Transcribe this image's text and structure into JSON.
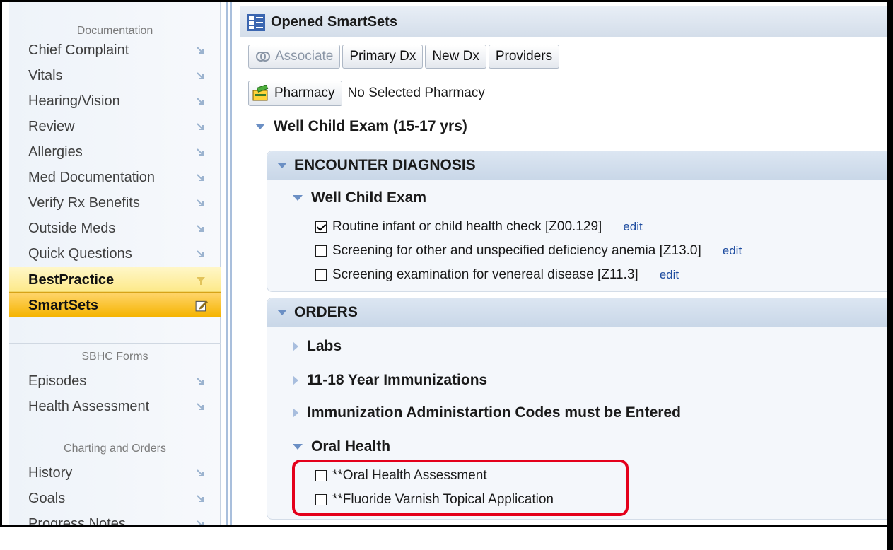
{
  "sidebar": {
    "sections": [
      {
        "heading": "Documentation",
        "items": [
          {
            "label": "Chief Complaint"
          },
          {
            "label": "Vitals"
          },
          {
            "label": "Hearing/Vision"
          },
          {
            "label": "Review"
          },
          {
            "label": "Allergies"
          },
          {
            "label": "Med Documentation"
          },
          {
            "label": "Verify Rx Benefits"
          },
          {
            "label": "Outside Meds"
          },
          {
            "label": "Quick Questions"
          },
          {
            "label": "BestPractice"
          },
          {
            "label": "SmartSets"
          }
        ]
      },
      {
        "heading": "SBHC Forms",
        "items": [
          {
            "label": "Episodes"
          },
          {
            "label": "Health Assessment"
          }
        ]
      },
      {
        "heading": "Charting and Orders",
        "items": [
          {
            "label": "History"
          },
          {
            "label": "Goals"
          },
          {
            "label": "Progress Notes"
          }
        ]
      }
    ]
  },
  "main": {
    "title": "Opened SmartSets",
    "toolbar": {
      "associate": "Associate",
      "primary_dx": "Primary Dx",
      "new_dx": "New Dx",
      "providers": "Providers"
    },
    "pharmacy": {
      "button": "Pharmacy",
      "status": "No Selected Pharmacy"
    },
    "smartset_name": "Well Child Exam (15-17  yrs)",
    "encounter_diagnosis": {
      "title": "ENCOUNTER DIAGNOSIS",
      "group": "Well Child Exam",
      "items": [
        {
          "label": "Routine infant or child health check [Z00.129]",
          "checked": true,
          "edit": "edit"
        },
        {
          "label": "Screening for other and unspecified deficiency anemia [Z13.0]",
          "checked": false,
          "edit": "edit"
        },
        {
          "label": "Screening examination for venereal disease [Z11.3]",
          "checked": false,
          "edit": "edit"
        }
      ]
    },
    "orders": {
      "title": "ORDERS",
      "groups": [
        {
          "label": "Labs"
        },
        {
          "label": "11-18 Year Immunizations"
        },
        {
          "label": "Immunization Administartion Codes must be Entered"
        }
      ],
      "oral_health": {
        "title": "Oral Health",
        "items": [
          {
            "label": "**Oral Health Assessment",
            "checked": false
          },
          {
            "label": "**Fluoride Varnish Topical Application",
            "checked": false
          }
        ]
      }
    }
  },
  "colors": {
    "accent_blue": "#6b8fc4",
    "active_yellow": "#f5b400",
    "highlight_red": "#e4001b",
    "edit_link": "#1f4da0"
  }
}
